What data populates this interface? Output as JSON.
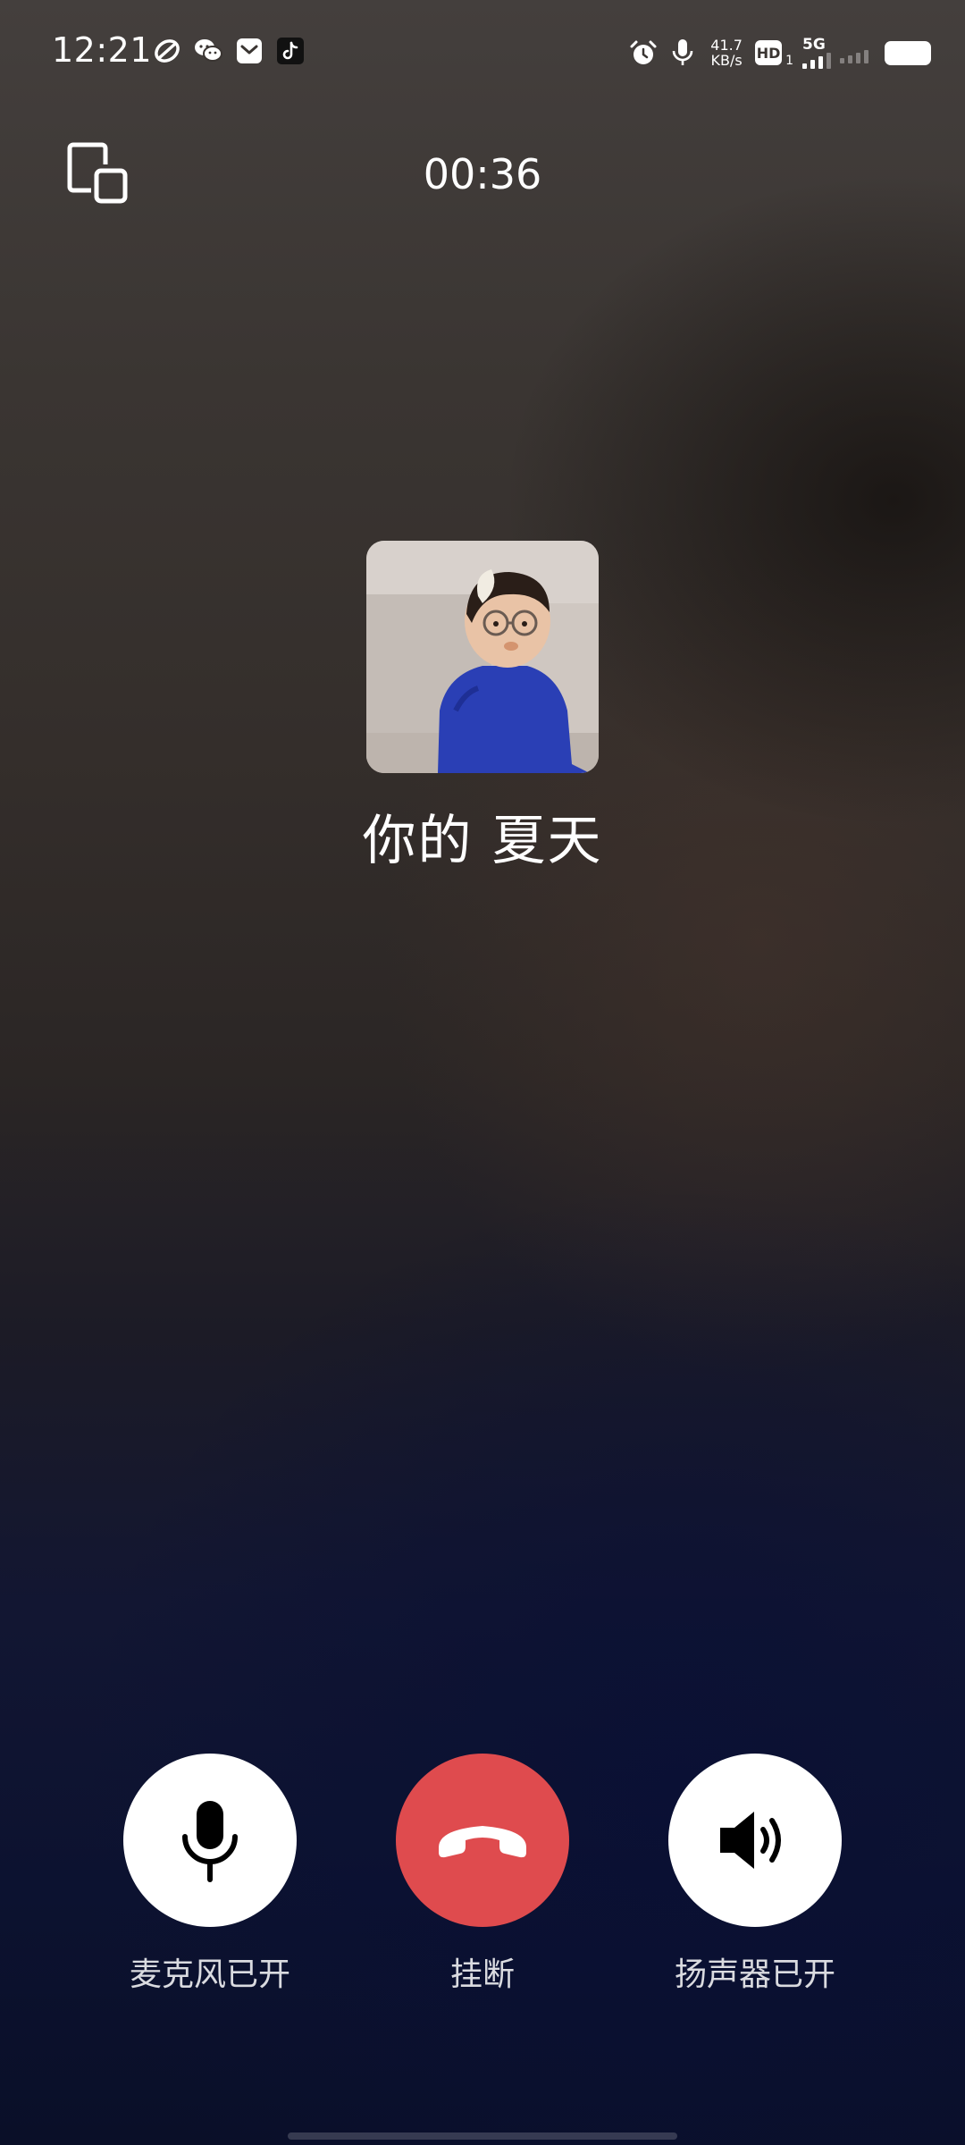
{
  "status_bar": {
    "time": "12:21",
    "notification_icons": [
      "nfc-icon",
      "wechat-icon",
      "mail-icon",
      "tiktok-icon"
    ],
    "status_icons": [
      "alarm-icon",
      "mic-icon"
    ],
    "network_speed_value": "41.7",
    "network_speed_unit": "KB/s",
    "hd_label": "HD",
    "hd_sim": "1",
    "network_type": "5G"
  },
  "call": {
    "timer": "00:36",
    "contact_name": "你的  夏天"
  },
  "controls": {
    "mic_label": "麦克风已开",
    "hangup_label": "挂断",
    "speaker_label": "扬声器已开"
  },
  "colors": {
    "hangup": "#df4b4e",
    "control_bg": "#ffffff",
    "text": "#ffffff"
  }
}
